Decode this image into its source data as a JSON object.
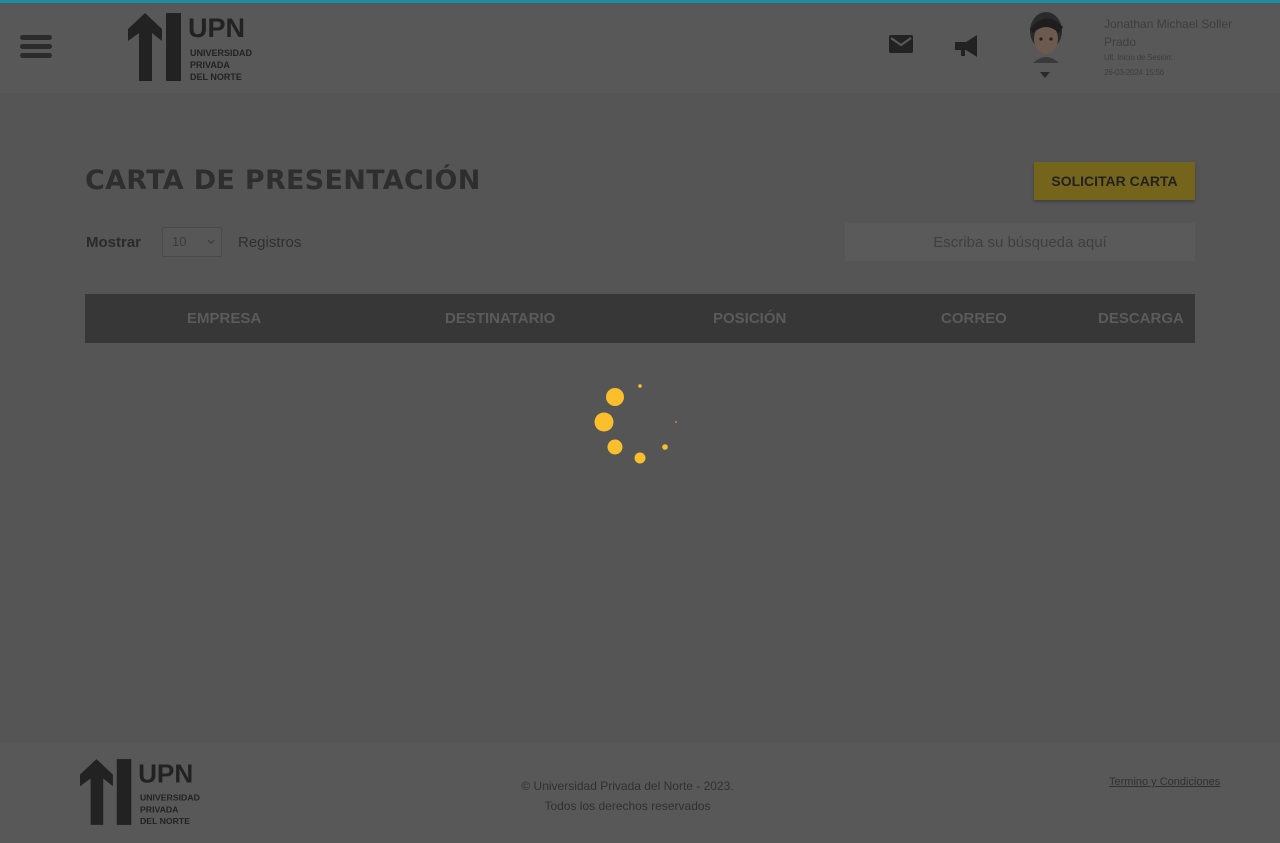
{
  "header": {
    "logo": {
      "acronym": "UPN",
      "line1": "UNIVERSIDAD",
      "line2": "PRIVADA",
      "line3": "DEL NORTE"
    },
    "user": {
      "name": "Jonathan Michael Soller Prado",
      "last_login_label": "Ult. Inicio de Sesión:",
      "last_login_value": "26-03-2024 15:56"
    },
    "icons": [
      "menu-icon",
      "mail-icon",
      "megaphone-icon",
      "chevron-down-icon"
    ]
  },
  "main": {
    "title": "CARTA DE PRESENTACIÓN",
    "solicitar_label": "SOLICITAR CARTA",
    "mostrar_label": "Mostrar",
    "page_size": "10",
    "registros_label": "Registros",
    "search_placeholder": "Escriba su búsqueda aquí",
    "columns": [
      "EMPRESA",
      "DESTINATARIO",
      "POSICIÓN",
      "CORREO",
      "DESCARGA"
    ]
  },
  "footer": {
    "copyright_line1": "© Universidad Privada del Norte - 2023.",
    "copyright_line2": "Todos los derechos reservados",
    "terms_label": "Termino y Condiciones"
  },
  "colors": {
    "overlay_bg": "#555555",
    "accent": "#1a8fa0",
    "spinner": "#fbbf2e",
    "button": "#75651c"
  }
}
